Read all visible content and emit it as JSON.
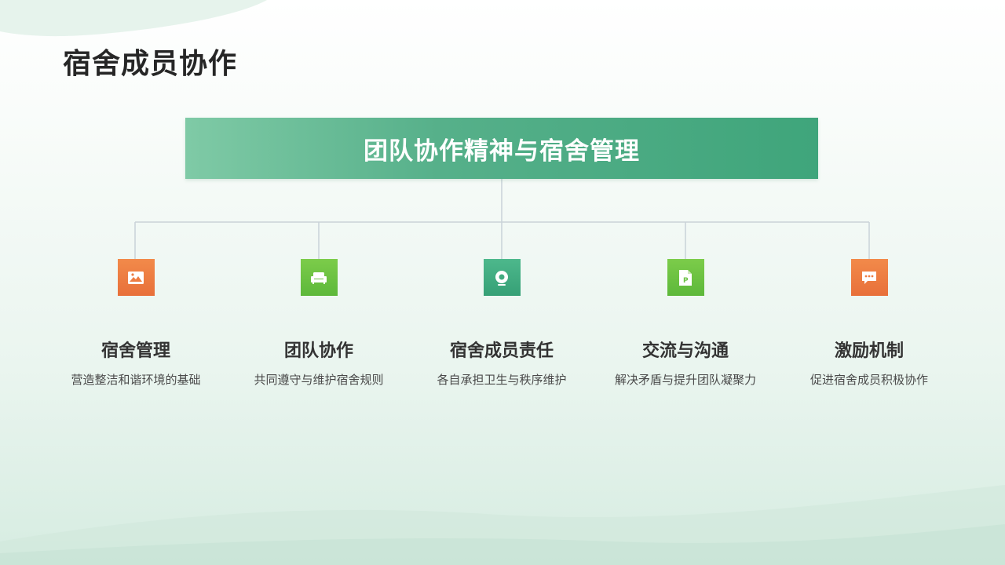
{
  "page": {
    "title": "宿舍成员协作"
  },
  "diagram": {
    "root": {
      "label": "团队协作精神与宿舍管理"
    },
    "nodes": [
      {
        "title": "宿舍管理",
        "description": "营造整洁和谐环境的基础",
        "icon": "image-icon",
        "color": "#EE7D43"
      },
      {
        "title": "团队协作",
        "description": "共同遵守与维护宿舍规则",
        "icon": "sofa-icon",
        "color": "#6BC244"
      },
      {
        "title": "宿舍成员责任",
        "description": "各自承担卫生与秩序维护",
        "icon": "webcam-icon",
        "color": "#43AB80"
      },
      {
        "title": "交流与沟通",
        "description": "解决矛盾与提升团队凝聚力",
        "icon": "presentation-file-icon",
        "color": "#6BC244"
      },
      {
        "title": "激励机制",
        "description": "促进宿舍成员积极协作",
        "icon": "chat-bubble-icon",
        "color": "#EE7D43"
      }
    ]
  },
  "theme": {
    "accent_green": "#4BAA80",
    "connector": "#C9D3D8",
    "text_dark": "#262626"
  }
}
